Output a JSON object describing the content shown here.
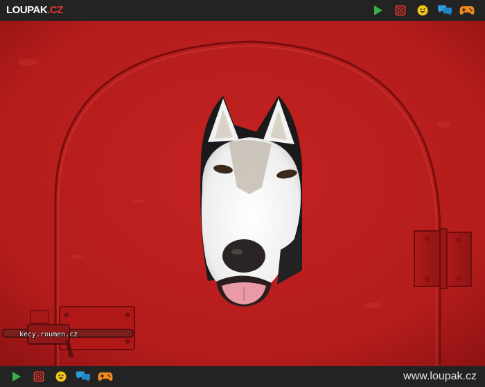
{
  "header": {
    "logo_main": "LOUPAK",
    "logo_tld": ".CZ",
    "icons": [
      "play-icon",
      "instagram-icon",
      "smiley-icon",
      "chat-icon",
      "gamepad-icon"
    ]
  },
  "photo": {
    "watermark": "kecy.roumen.cz"
  },
  "footer": {
    "site_url": "www.loupak.cz",
    "icons": [
      "play-icon",
      "instagram-icon",
      "smiley-icon",
      "chat-icon",
      "gamepad-icon"
    ]
  },
  "colors": {
    "bar": "#232323",
    "brand_red": "#e8342c",
    "play": "#35b34a",
    "instagram": "#e4322b",
    "smiley": "#f5c518",
    "chat": "#2d9cdb",
    "gamepad": "#f28a1e"
  }
}
